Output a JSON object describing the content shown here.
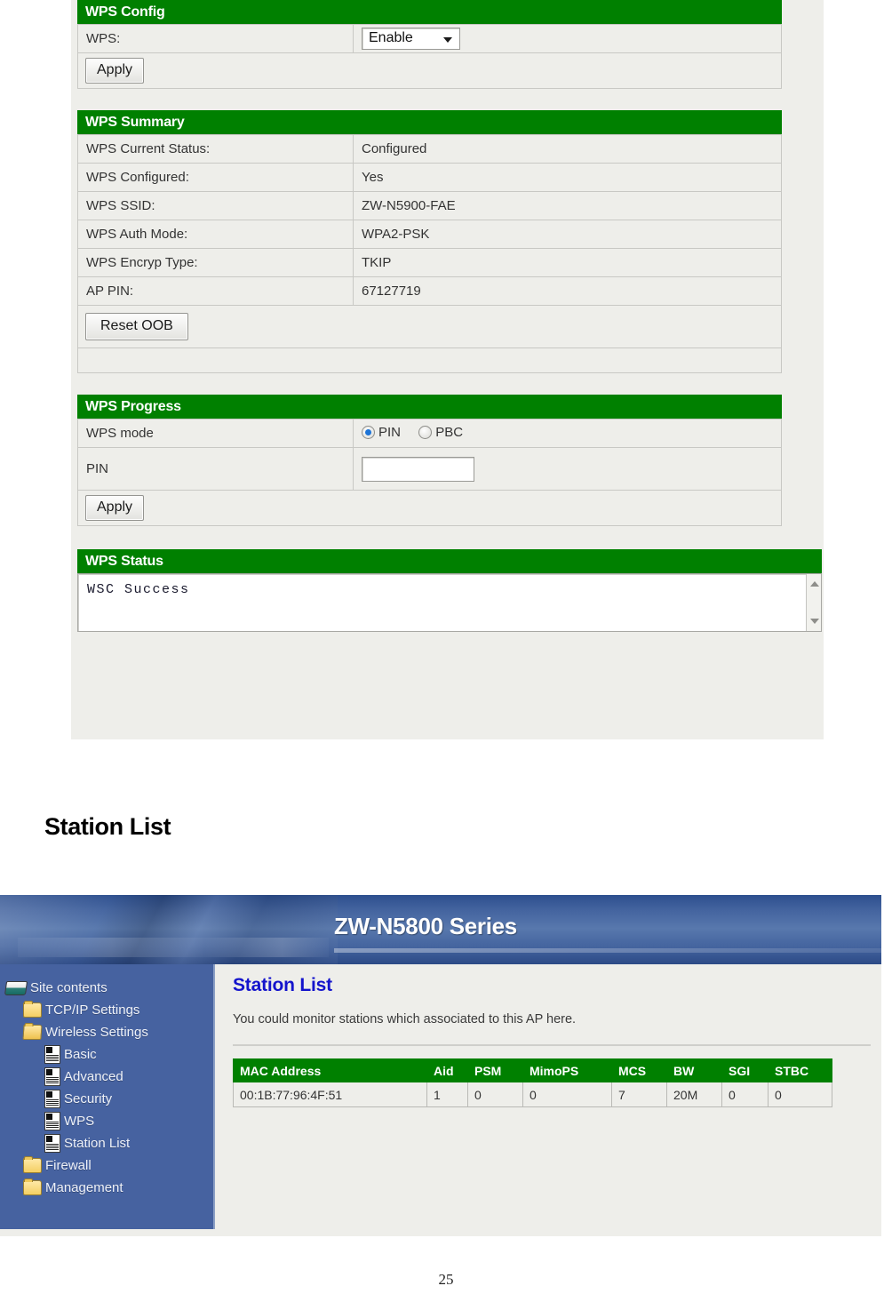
{
  "wps_screenshot": {
    "config": {
      "header": "WPS Config",
      "wps_label": "WPS:",
      "wps_value": "Enable",
      "apply_label": "Apply"
    },
    "summary": {
      "header": "WPS Summary",
      "rows": [
        {
          "label": "WPS Current Status:",
          "value": "Configured"
        },
        {
          "label": "WPS Configured:",
          "value": "Yes"
        },
        {
          "label": "WPS SSID:",
          "value": "ZW-N5900-FAE"
        },
        {
          "label": "WPS Auth Mode:",
          "value": "WPA2-PSK"
        },
        {
          "label": "WPS Encryp Type:",
          "value": "TKIP"
        },
        {
          "label": "AP PIN:",
          "value": "67127719"
        }
      ],
      "reset_label": "Reset OOB"
    },
    "progress": {
      "header": "WPS Progress",
      "mode_label": "WPS mode",
      "mode_pin": "PIN",
      "mode_pbc": "PBC",
      "selected_mode": "PIN",
      "pin_label": "PIN",
      "pin_value": "",
      "apply_label": "Apply"
    },
    "status": {
      "header": "WPS Status",
      "message": "WSC Success"
    }
  },
  "document": {
    "section_heading": "Station List",
    "page_number": "25"
  },
  "station_list_screenshot": {
    "banner": {
      "title": "ZW-N5800 Series"
    },
    "sidebar": {
      "root": {
        "label": "Site contents",
        "icon": "site-contents-icon"
      },
      "items": [
        {
          "label": "TCP/IP Settings",
          "icon": "folder-icon",
          "level": 1
        },
        {
          "label": "Wireless Settings",
          "icon": "folder-open-icon",
          "level": 1
        },
        {
          "label": "Basic",
          "icon": "page-icon",
          "level": 2
        },
        {
          "label": "Advanced",
          "icon": "page-icon",
          "level": 2
        },
        {
          "label": "Security",
          "icon": "page-icon",
          "level": 2
        },
        {
          "label": "WPS",
          "icon": "page-icon",
          "level": 2
        },
        {
          "label": "Station List",
          "icon": "page-icon",
          "level": 2
        },
        {
          "label": "Firewall",
          "icon": "folder-icon",
          "level": 1
        },
        {
          "label": "Management",
          "icon": "folder-icon",
          "level": 1
        }
      ]
    },
    "main": {
      "title": "Station List",
      "description": "You could monitor stations which associated to this AP here.",
      "table": {
        "columns": [
          "MAC Address",
          "Aid",
          "PSM",
          "MimoPS",
          "MCS",
          "BW",
          "SGI",
          "STBC"
        ],
        "rows": [
          [
            "00:1B:77:96:4F:51",
            "1",
            "0",
            "0",
            "7",
            "20M",
            "0",
            "0"
          ]
        ]
      }
    }
  },
  "colors": {
    "green_header": "#008000",
    "sidebar_blue": "#4662a0",
    "panel_bg": "#eeeeea",
    "title_blue": "#1414cc"
  }
}
